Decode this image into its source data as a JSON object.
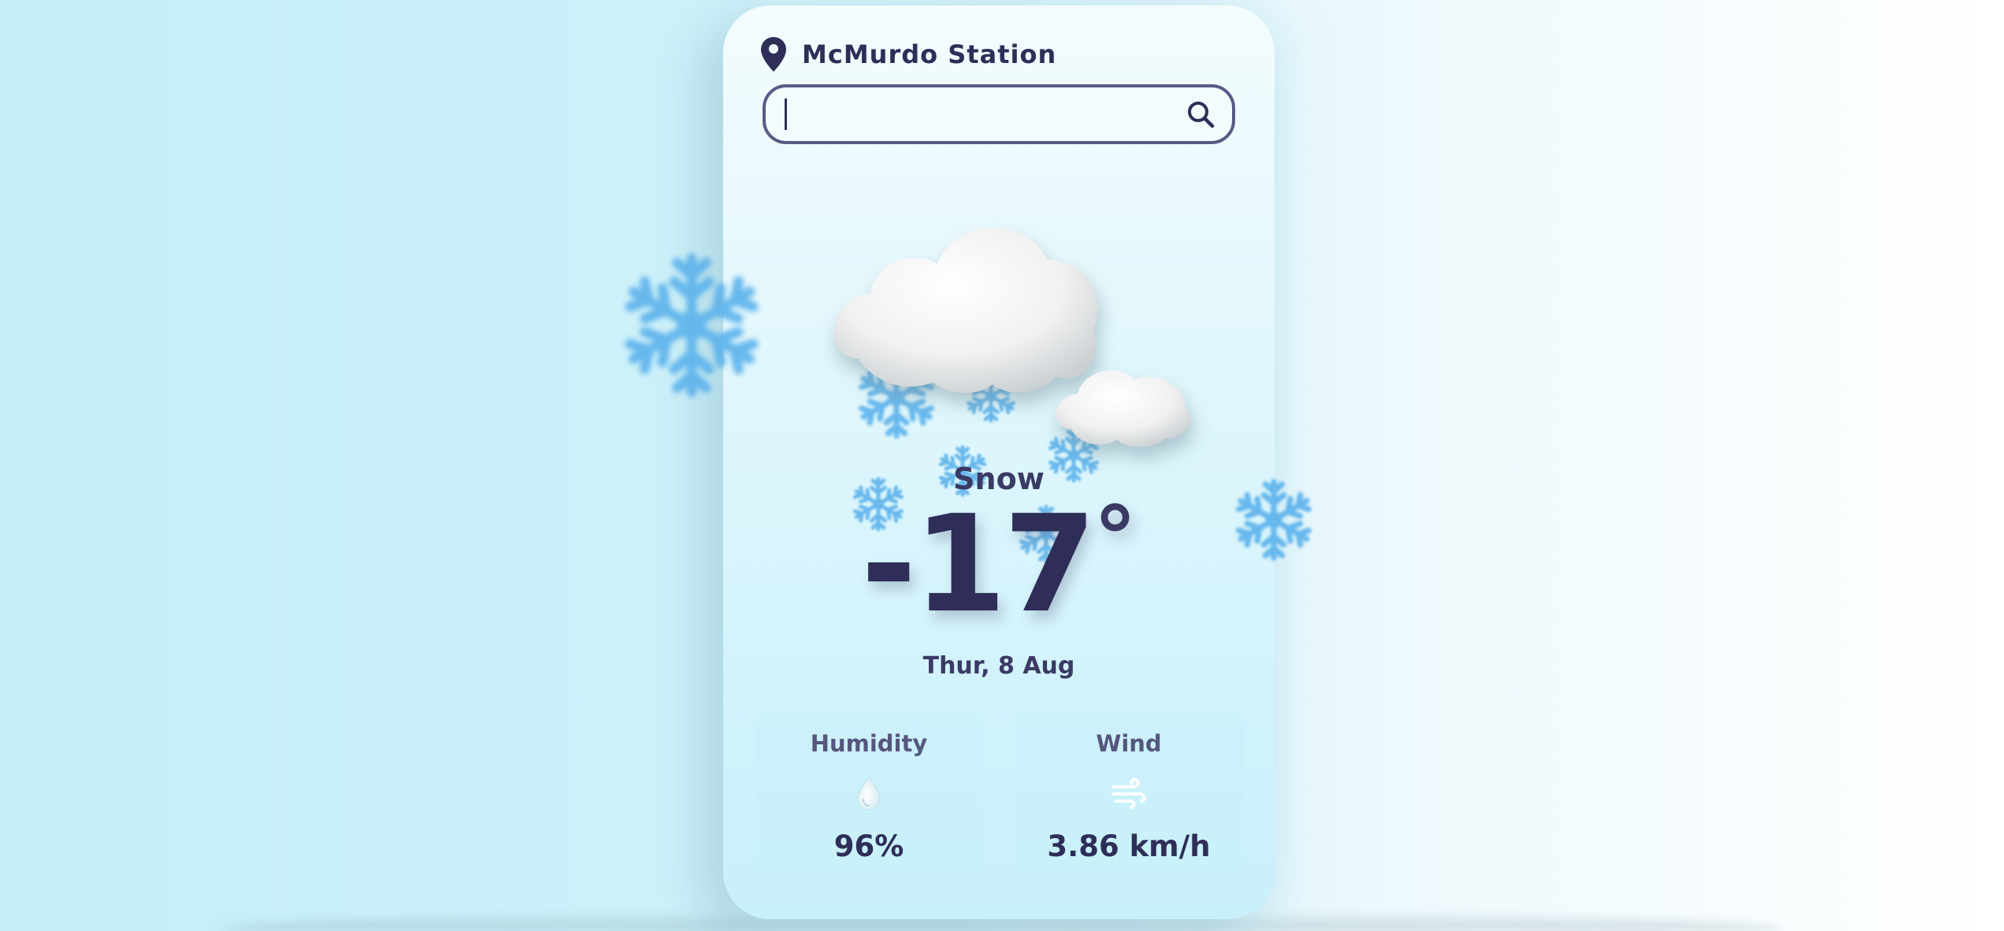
{
  "location": {
    "name": "McMurdo Station",
    "icon": "map-pin-icon"
  },
  "search": {
    "value": "",
    "placeholder": "",
    "icon": "search-icon"
  },
  "weather": {
    "condition": "Snow",
    "illustration": "snow-cloud-icon",
    "temperature": "-17",
    "degree_symbol": "°",
    "date": "Thur, 8 Aug"
  },
  "stats": {
    "humidity": {
      "label": "Humidity",
      "value": "96%",
      "icon": "water-drop-icon"
    },
    "wind": {
      "label": "Wind",
      "value": "3.86 km/h",
      "icon": "wind-icon"
    }
  },
  "colors": {
    "text_primary": "#2e2e58",
    "text_secondary": "#56567e",
    "snowflake": "#5db3ec",
    "background_start": "#c3eef8",
    "background_end": "#ffffff"
  }
}
